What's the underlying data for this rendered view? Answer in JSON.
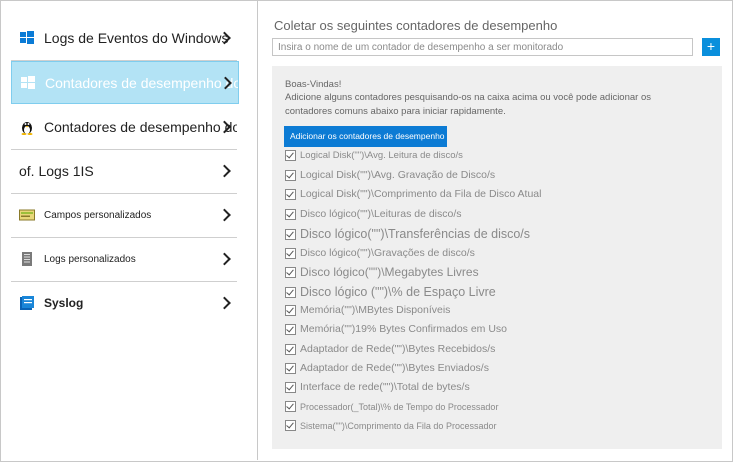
{
  "sidebar": {
    "items": [
      {
        "label": "Logs de Eventos do Windows",
        "icon": "windows-icon"
      },
      {
        "label": "Contadores de desempenho do Windows",
        "icon": "windows-icon"
      },
      {
        "label": "Contadores de desempenho do Linux",
        "icon": "linux-icon"
      },
      {
        "label": "of. Logs 1IS",
        "icon": ""
      },
      {
        "label": "Campos personalizados",
        "icon": "custom-fields-icon"
      },
      {
        "label": "Logs personalizados",
        "icon": "custom-logs-icon"
      },
      {
        "label": "Syslog",
        "icon": "syslog-icon"
      }
    ],
    "selected_index": 1
  },
  "panel": {
    "title": "Coletar os seguintes contadores de desempenho",
    "search_placeholder": "Insira o nome de um contador de desempenho a ser monitorado",
    "add_symbol": "+",
    "welcome": "Boas-Vindas!",
    "intro": "Adicione alguns contadores pesquisando-os na caixa acima ou você pode adicionar os contadores comuns abaixo para iniciar rapidamente.",
    "add_common_label": "Adicionar os contadores de desempenho selecionados"
  },
  "counters": [
    {
      "label": "Logical Disk(\"\")\\Avg. Leitura de disco/s",
      "checked": true
    },
    {
      "label": "Logical Disk(\"\")\\Avg. Gravação de Disco/s",
      "checked": true
    },
    {
      "label": "Logical Disk(\"\")\\Comprimento da Fila de Disco Atual",
      "checked": true
    },
    {
      "label": "Disco lógico(\"\")\\Leituras de disco/s",
      "checked": true
    },
    {
      "label": "Disco lógico(\"\")\\Transferências de disco/s",
      "checked": true
    },
    {
      "label": "Disco lógico(\"\")\\Gravações de disco/s",
      "checked": true
    },
    {
      "label": "Disco lógico(\"\")\\Megabytes Livres",
      "checked": true
    },
    {
      "label": "Disco lógico (\"\")\\% de Espaço Livre",
      "checked": true
    },
    {
      "label": "Memória(\"\")\\MBytes Disponíveis",
      "checked": true
    },
    {
      "label": "Memória(\"\")19% Bytes Confirmados em Uso",
      "checked": true
    },
    {
      "label": "Adaptador de Rede(\"\")\\Bytes Recebidos/s",
      "checked": true
    },
    {
      "label": "Adaptador de Rede(\"\")\\Bytes Enviados/s",
      "checked": true
    },
    {
      "label": "Interface de rede(\"\")\\Total de bytes/s",
      "checked": true
    },
    {
      "label": "Processador(_Total)\\% de Tempo do Processador",
      "checked": true
    },
    {
      "label": "Sistema(\"\")\\Comprimento da Fila do Processador",
      "checked": true
    }
  ]
}
